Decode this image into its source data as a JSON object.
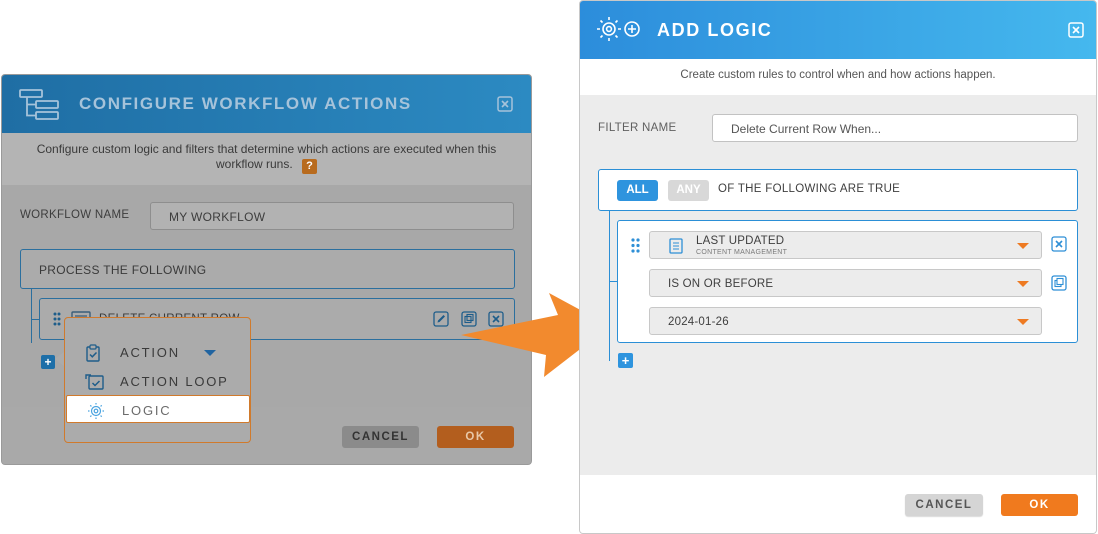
{
  "left_dialog": {
    "title": "CONFIGURE WORKFLOW ACTIONS",
    "header_icon": "workflow-tree-icon",
    "description": "Configure custom logic and filters that determine which actions are executed when this workflow runs.",
    "help_label": "?",
    "workflow_name_label": "WORKFLOW NAME",
    "workflow_name_value": "MY WORKFLOW",
    "process_label": "PROCESS THE FOLLOWING",
    "action_row_text": "DELETE CURRENT ROW",
    "add_label": "+",
    "cancel_label": "CANCEL",
    "ok_label": "OK"
  },
  "popup_menu": {
    "items": [
      {
        "label": "ACTION",
        "icon": "clipboard-check-icon"
      },
      {
        "label": "ACTION LOOP",
        "icon": "loop-check-icon"
      },
      {
        "label": "LOGIC",
        "icon": "lightbulb-icon"
      }
    ],
    "selected": "LOGIC"
  },
  "right_dialog": {
    "title": "ADD LOGIC",
    "header_icon": "lightbulb-plus-icon",
    "description": "Create custom rules to control when and how actions happen.",
    "filter_name_label": "FILTER NAME",
    "filter_name_value": "Delete Current Row When...",
    "all_label": "ALL",
    "any_label": "ANY",
    "condition_text": "OF THE FOLLOWING ARE TRUE",
    "field_name": "LAST UPDATED",
    "field_category": "CONTENT MANAGEMENT",
    "operator": "IS ON OR BEFORE",
    "value": "2024-01-26",
    "add_label": "+",
    "cancel_label": "CANCEL",
    "ok_label": "OK"
  },
  "colors": {
    "accent_blue": "#2e94de",
    "accent_orange": "#f07a1e",
    "left_header": "#1f6ea4",
    "overlay_gray": "#a9a9a9"
  }
}
